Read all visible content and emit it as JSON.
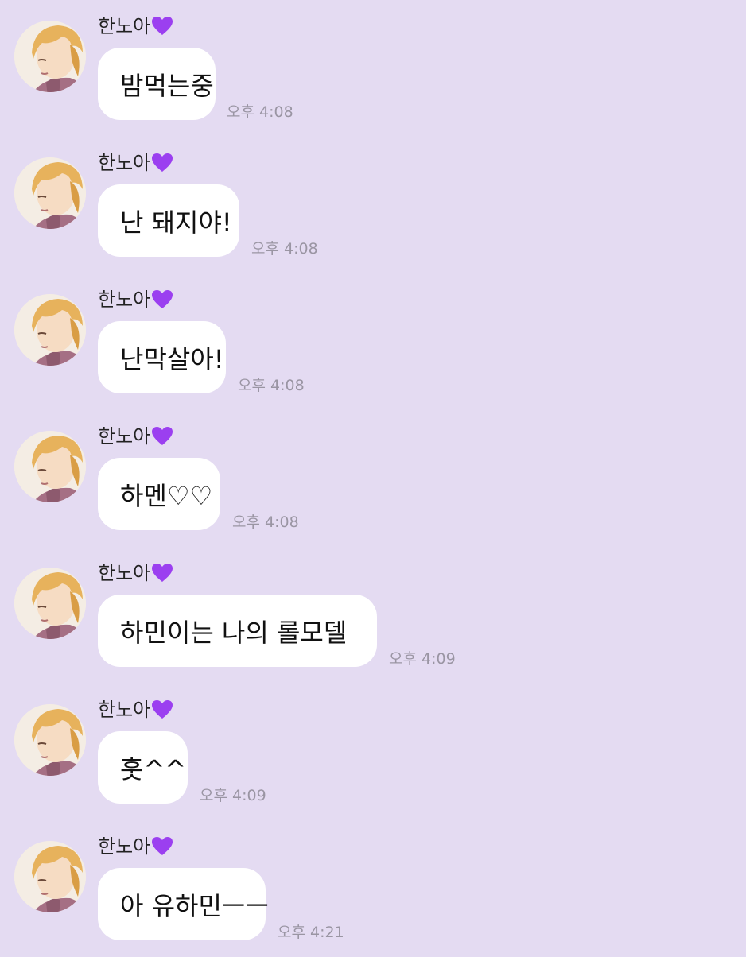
{
  "colors": {
    "background": "#e4dbf2",
    "bubble": "#ffffff",
    "heart": "#9b3ff0",
    "timestamp": "#9a95a3"
  },
  "messages": [
    {
      "sender": "한노아",
      "text": "밤먹는중",
      "time": "오후 4:08"
    },
    {
      "sender": "한노아",
      "text": "난 돼지야!",
      "time": "오후 4:08"
    },
    {
      "sender": "한노아",
      "text": "난막살아!",
      "time": "오후 4:08"
    },
    {
      "sender": "한노아",
      "text": "하멘♡♡",
      "time": "오후 4:08"
    },
    {
      "sender": "한노아",
      "text": "하민이는 나의 롤모델",
      "time": "오후 4:09",
      "sticker": "bird-doodle-icon"
    },
    {
      "sender": "한노아",
      "text": "훗^^",
      "time": "오후 4:09"
    },
    {
      "sender": "한노아",
      "text": "아 유하민ㅡㅡ",
      "time": "오후 4:21"
    }
  ]
}
